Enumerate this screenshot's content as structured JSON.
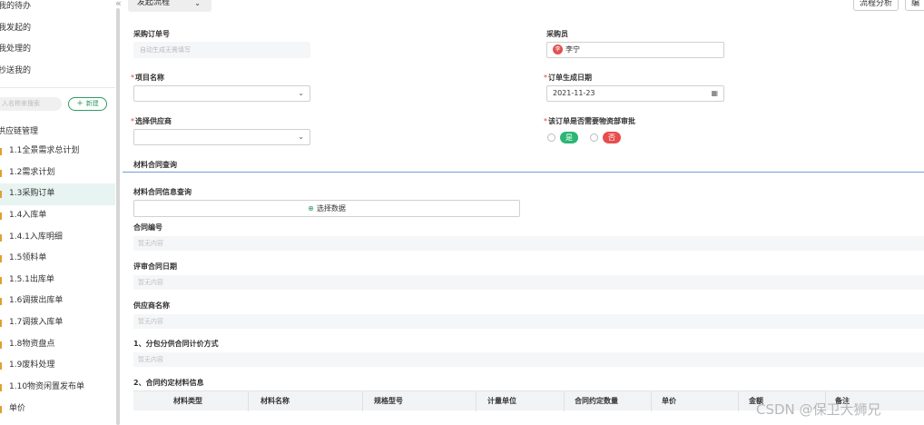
{
  "sidebar": {
    "top_items": [
      {
        "label": "我的待办"
      },
      {
        "label": "我发起的"
      },
      {
        "label": "我处理的"
      },
      {
        "label": "抄送我的"
      }
    ],
    "search_placeholder": "入名称来搜索",
    "new_button": "新建",
    "tree_root": "供应链管理",
    "tree_items": [
      {
        "label": "1.1全景需求总计划"
      },
      {
        "label": "1.2需求计划"
      },
      {
        "label": "1.3采购订单"
      },
      {
        "label": "1.4入库单"
      },
      {
        "label": "1.4.1入库明细"
      },
      {
        "label": "1.5领料单"
      },
      {
        "label": "1.5.1出库单"
      },
      {
        "label": "1.6调拨出库单"
      },
      {
        "label": "1.7调拨入库单"
      },
      {
        "label": "1.8物资盘点"
      },
      {
        "label": "1.9废料处理"
      },
      {
        "label": "1.10物资闲置发布单"
      },
      {
        "label": "单价"
      }
    ],
    "active_item": "1.3采购订单"
  },
  "toolbar": {
    "process_select": "发起流程",
    "analysis_button": "流程分析",
    "extra_button": "编"
  },
  "form": {
    "order_no_label": "采购订单号",
    "order_no_placeholder": "自动生成无需填写",
    "buyer_label": "采购员",
    "buyer_avatar": "李",
    "buyer_name": "李宁",
    "project_label": "项目名称",
    "date_label": "订单生成日期",
    "date_value": "2021-11-23",
    "supplier_label": "选择供应商",
    "approval_label": "该订单是否需要物资部审批",
    "yes_label": "是",
    "no_label": "否"
  },
  "contract": {
    "section_title": "材料合同查询",
    "query_label": "材料合同信息查询",
    "select_data": "选择数据",
    "contract_no_label": "合同编号",
    "review_date_label": "评审合同日期",
    "supplier_name_label": "供应商名称",
    "pricing_label": "1、分包分供合同计价方式",
    "materials_label": "2、合同约定材料信息",
    "empty_text": "暂无内容"
  },
  "table": {
    "columns": [
      "材料类型",
      "材料名称",
      "规格型号",
      "计量单位",
      "合同约定数量",
      "单价",
      "金额",
      "备注"
    ]
  },
  "watermark": "CSDN @保卫大狮兄"
}
